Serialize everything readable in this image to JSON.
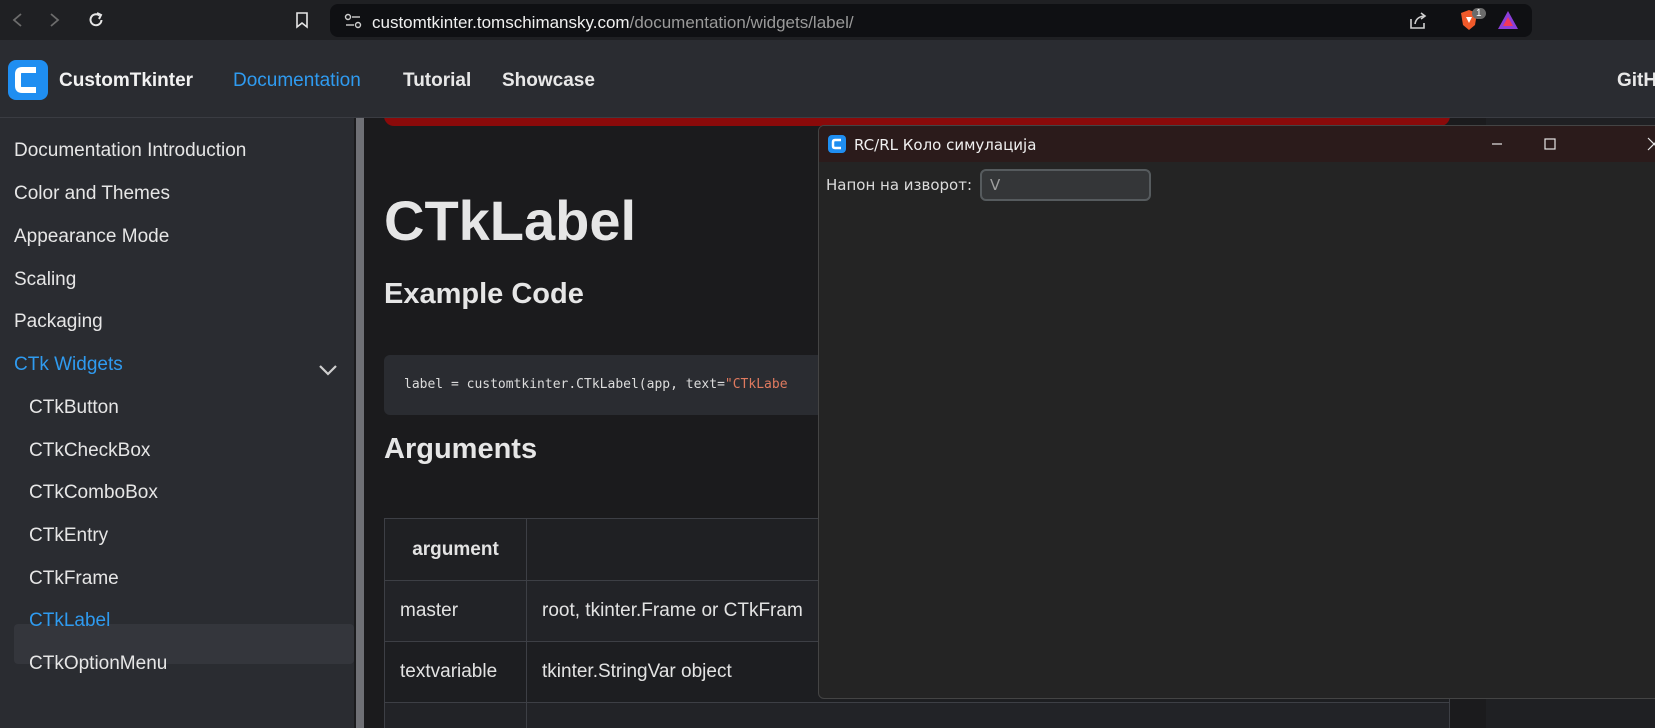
{
  "browser": {
    "url_host": "customtkinter.tomschimansky.com",
    "url_path": "/documentation/widgets/label/",
    "brave_badge": "1"
  },
  "site": {
    "brand": "CustomTkinter",
    "nav": [
      "Documentation",
      "Tutorial",
      "Showcase",
      "GitH"
    ]
  },
  "sidebar": {
    "items": [
      "Documentation Introduction",
      "Color and Themes",
      "Appearance Mode",
      "Scaling",
      "Packaging",
      "CTk Widgets"
    ],
    "widgets": [
      "CTkButton",
      "CTkCheckBox",
      "CTkComboBox",
      "CTkEntry",
      "CTkFrame",
      "CTkLabel",
      "CTkOptionMenu"
    ],
    "active_color": "#2f9bf0"
  },
  "main": {
    "title": "CTkLabel",
    "example_heading": "Example Code",
    "code_plain": "label = customtkinter.CTkLabel(app, text=",
    "code_string": "\"CTkLabe",
    "arguments_heading": "Arguments",
    "table_header": [
      "argument",
      ""
    ],
    "rows": [
      [
        "master",
        "root, tkinter.Frame or CTkFram"
      ],
      [
        "textvariable",
        "tkinter.StringVar object"
      ]
    ]
  },
  "tk_window": {
    "title": "RC/RL Коло симулација",
    "voltage_label": "Напон на изворот:",
    "voltage_placeholder": "V"
  }
}
